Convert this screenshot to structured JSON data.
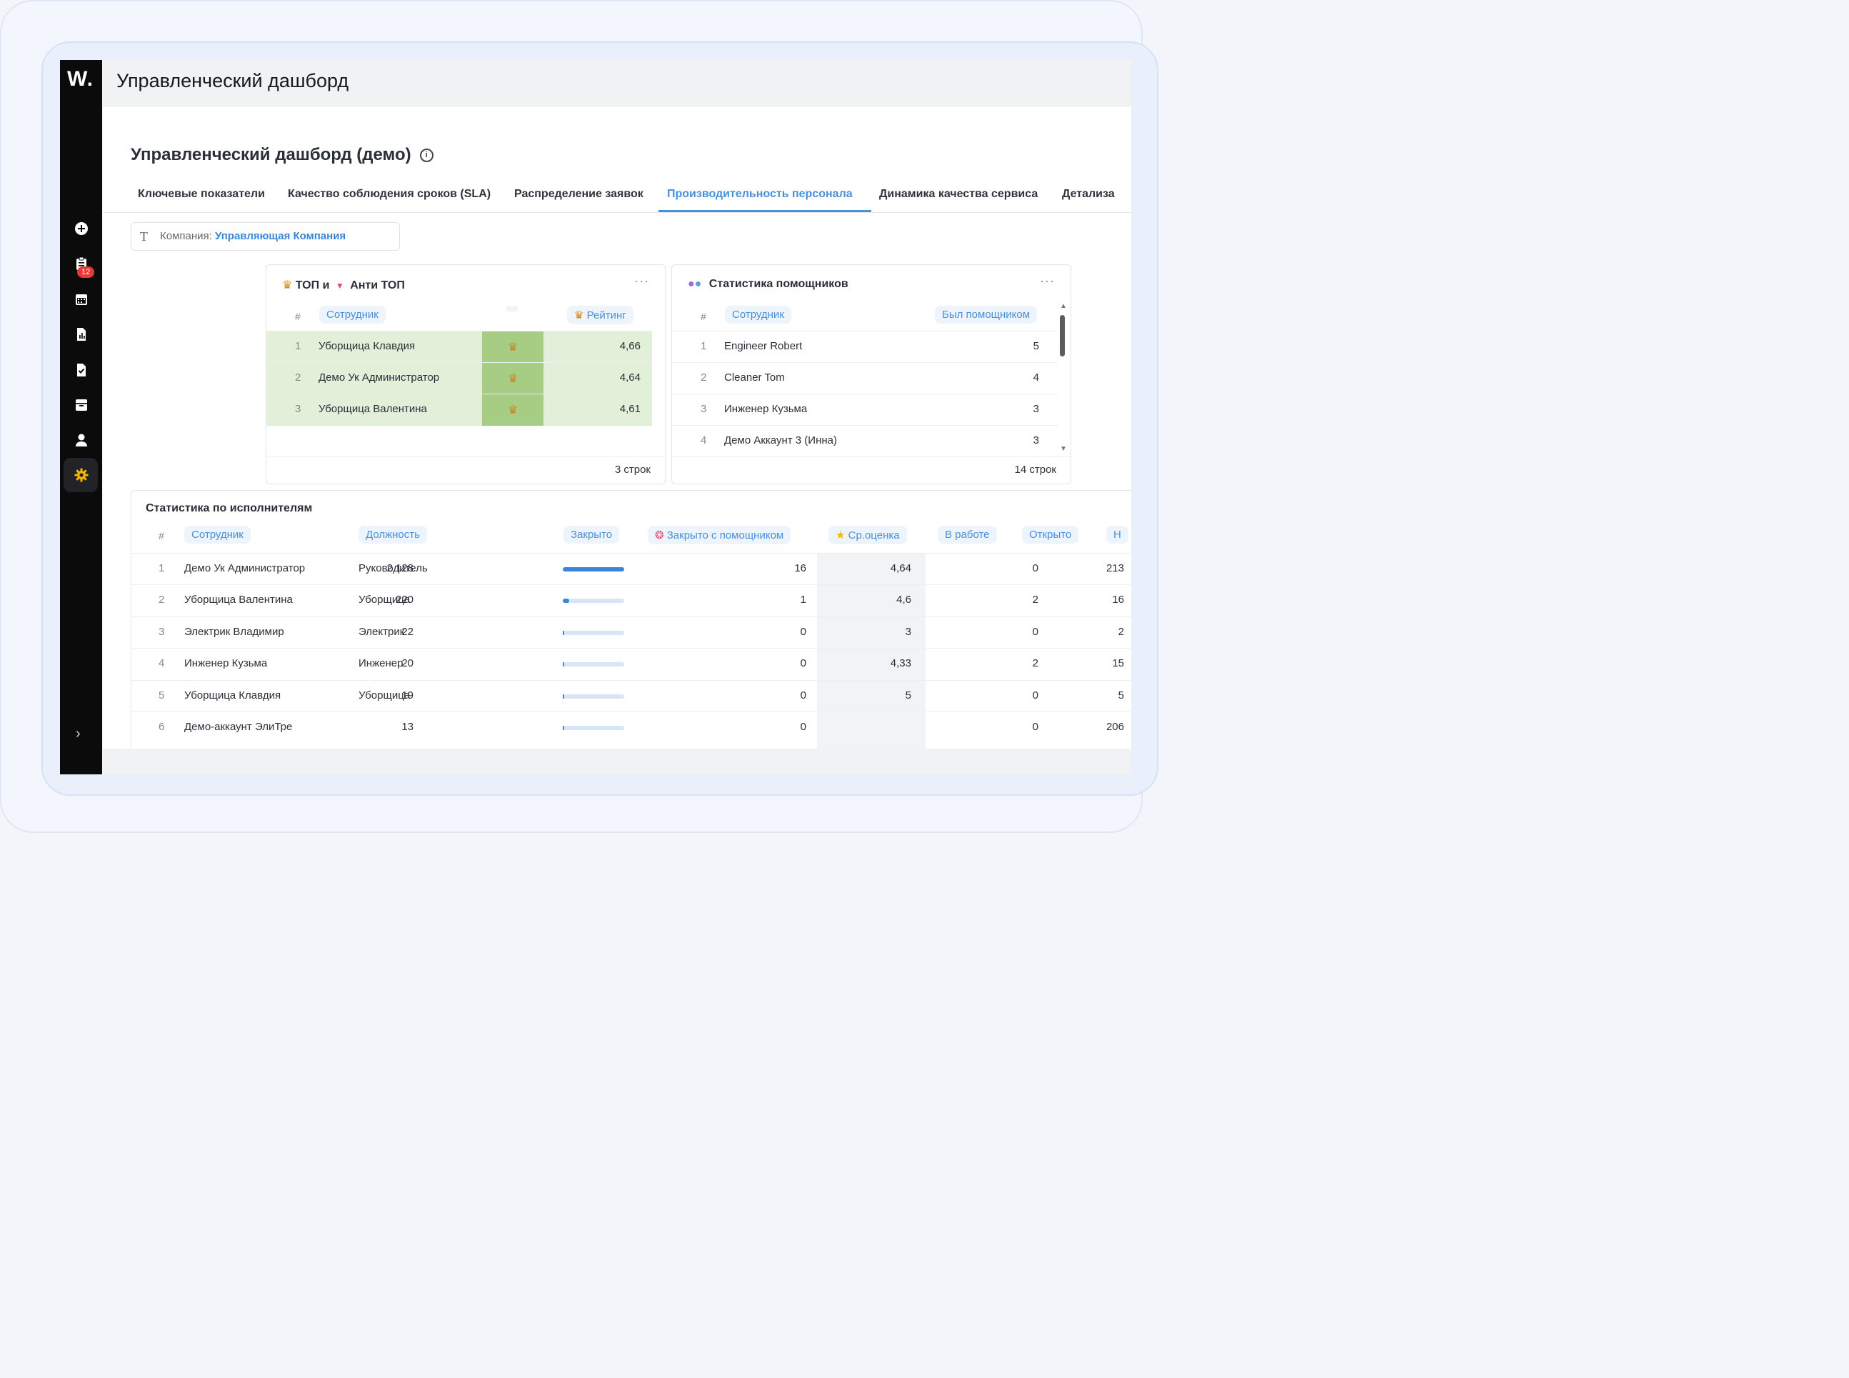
{
  "app": {
    "logo": "W.",
    "title": "Управленческий дашборд",
    "notification_count": "12"
  },
  "sidebar_icons": [
    "plus-icon",
    "clipboard-icon",
    "calendar-icon",
    "report-icon",
    "task-check-icon",
    "archive-icon",
    "user-icon",
    "gear-icon"
  ],
  "page": {
    "title": "Управленческий дашборд (демо)",
    "info_glyph": "i"
  },
  "tabs": [
    {
      "label": "Ключевые показатели"
    },
    {
      "label": "Качество соблюдения сроков (SLA)"
    },
    {
      "label": "Распределение заявок"
    },
    {
      "label": "Производительность персонала"
    },
    {
      "label": "Динамика качества сервиса"
    },
    {
      "label": "Детализа"
    }
  ],
  "filter": {
    "label": "Компания:",
    "value": "Управляющая Компания"
  },
  "top_card": {
    "title_a": "ТОП и",
    "title_b": "Анти ТОП",
    "col_hash": "#",
    "col_employee": "Сотрудник",
    "col_rating": "Рейтинг",
    "rows": [
      {
        "n": "1",
        "name": "Уборщица Клавдия",
        "rating": "4,66"
      },
      {
        "n": "2",
        "name": "Демо Ук Администратор",
        "rating": "4,64"
      },
      {
        "n": "3",
        "name": "Уборщица Валентина",
        "rating": "4,61"
      }
    ],
    "footer": "3 строк",
    "highlight_color": "#e2efd9",
    "medal_cell_color": "#a6cd83"
  },
  "helpers_card": {
    "title": "Статистика помощников",
    "col_hash": "#",
    "col_employee": "Сотрудник",
    "col_helper": "Был помощником",
    "rows": [
      {
        "n": "1",
        "name": "Engineer Robert",
        "value": "5"
      },
      {
        "n": "2",
        "name": "Cleaner Tom",
        "value": "4"
      },
      {
        "n": "3",
        "name": "Инженер Кузьма",
        "value": "3"
      },
      {
        "n": "4",
        "name": "Демо Аккаунт 3 (Инна)",
        "value": "3"
      }
    ],
    "footer": "14 строк"
  },
  "executors_card": {
    "title": "Статистика по исполнителям",
    "col_hash": "#",
    "col_employee": "Сотрудник",
    "col_position": "Должность",
    "col_closed": "Закрыто",
    "col_closed_helper": "Закрыто с помощником",
    "col_avg": "Ср.оценка",
    "col_inwork": "В работе",
    "col_open": "Открыто",
    "col_next": "Н",
    "rows": [
      {
        "n": "1",
        "name": "Демо Ук Администратор",
        "position": "Руководитель",
        "closed": "2 128",
        "closed_frac": 1.0,
        "helper": "16",
        "avg": "4,64",
        "inwork": "0",
        "open": "213"
      },
      {
        "n": "2",
        "name": "Уборщица Валентина",
        "position": "Уборщица",
        "closed": "220",
        "closed_frac": 0.103,
        "helper": "1",
        "avg": "4,6",
        "inwork": "2",
        "open": "16"
      },
      {
        "n": "3",
        "name": "Электрик Владимир",
        "position": "Электрик",
        "closed": "22",
        "closed_frac": 0.01,
        "helper": "0",
        "avg": "3",
        "inwork": "0",
        "open": "2"
      },
      {
        "n": "4",
        "name": "Инженер Кузьма",
        "position": "Инженер",
        "closed": "20",
        "closed_frac": 0.009,
        "helper": "0",
        "avg": "4,33",
        "inwork": "2",
        "open": "15"
      },
      {
        "n": "5",
        "name": "Уборщица Клавдия",
        "position": "Уборщица",
        "closed": "19",
        "closed_frac": 0.009,
        "helper": "0",
        "avg": "5",
        "inwork": "0",
        "open": "5"
      },
      {
        "n": "6",
        "name": "Демо-аккаунт ЭлиТре",
        "position": "",
        "closed": "13",
        "closed_frac": 0.006,
        "helper": "0",
        "avg": "",
        "inwork": "0",
        "open": "206"
      }
    ]
  },
  "colors": {
    "accent": "#4a8fd9",
    "bar": "#3d85d6",
    "bar_track": "#d6e6f7",
    "badge": "#e53935",
    "rail": "#0b0b0c"
  }
}
